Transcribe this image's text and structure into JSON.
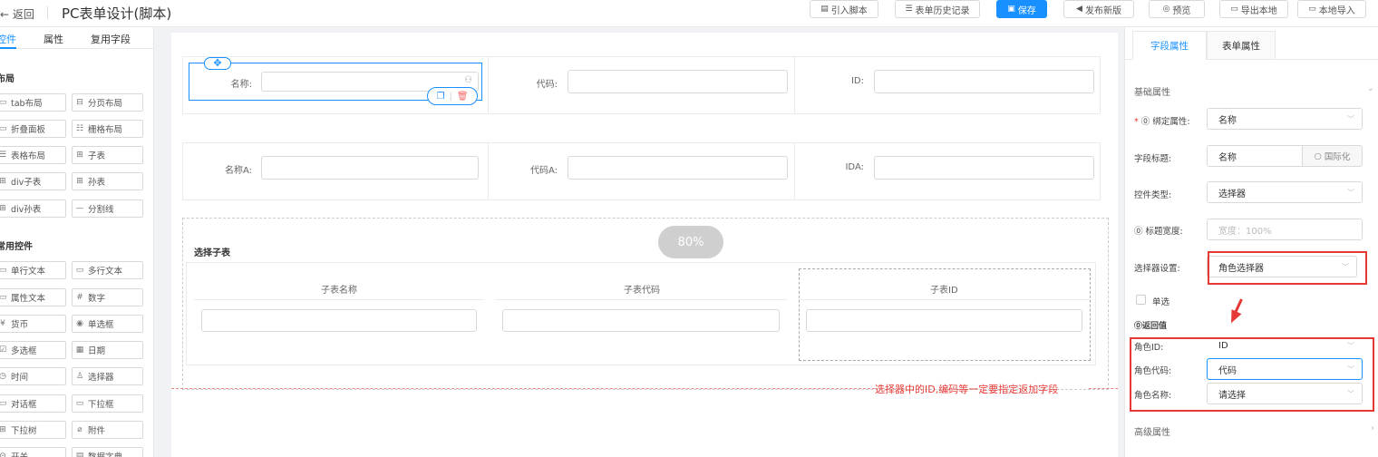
{
  "header": {
    "back": "返回",
    "title": "PC表单设计(脚本)",
    "buttons": {
      "import_script": "引入脚本",
      "history": "表单历史记录",
      "save": "保存",
      "publish": "发布新版",
      "preview": "预览",
      "export": "导出本地",
      "local_import": "本地导入"
    }
  },
  "left_panel": {
    "tabs": [
      "控件",
      "属性",
      "复用字段"
    ],
    "layout_title": "布局",
    "layout_items": [
      "tab布局",
      "分页布局",
      "折叠面板",
      "栅格布局",
      "表格布局",
      "子表",
      "div子表",
      "孙表",
      "div孙表",
      "分割线"
    ],
    "common_title": "常用控件",
    "common_items": [
      "单行文本",
      "多行文本",
      "属性文本",
      "数字",
      "货币",
      "单选框",
      "多选框",
      "日期",
      "时间",
      "选择器",
      "对话框",
      "下拉框",
      "下拉树",
      "附件",
      "开关",
      "数据字典"
    ]
  },
  "canvas": {
    "row1": {
      "name": "名称:",
      "code": "代码:",
      "id": "ID:"
    },
    "row2": {
      "name": "名称A:",
      "code": "代码A:",
      "id": "IDA:"
    },
    "zoom": "80%",
    "subtable_title": "选择子表",
    "subtable_headers": [
      "子表名称",
      "子表代码",
      "子表ID"
    ],
    "annotation": "选择器中的ID,编码等一定要指定返加字段"
  },
  "right_panel": {
    "tabs": [
      "字段属性",
      "表单属性"
    ],
    "basic_section": "基础属性",
    "props": {
      "bind_label": "绑定属性:",
      "bind_value": "名称",
      "field_title_label": "字段标题:",
      "field_title_value": "名称",
      "i18n": "国际化",
      "control_type_label": "控件类型:",
      "control_type_value": "选择器",
      "title_width_label": "标题宽度:",
      "title_width_placeholder": "宽度：100%",
      "selector_setting_label": "选择器设置:",
      "selector_setting_value": "角色选择器",
      "single_label": "单选",
      "return_title": "返回值",
      "role_id_label": "角色ID:",
      "role_id_value": "ID",
      "role_code_label": "角色代码:",
      "role_code_value": "代码",
      "role_name_label": "角色名称:",
      "role_name_value": "请选择"
    },
    "advanced_section": "高级属性"
  },
  "colors": {
    "primary": "#1890ff",
    "annotation": "#e53935"
  }
}
